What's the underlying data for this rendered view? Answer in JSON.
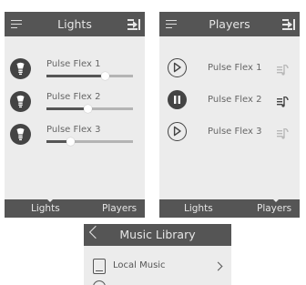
{
  "lights_screen": {
    "title": "Lights",
    "items": [
      {
        "name": "Pulse Flex 1",
        "level": 0.67
      },
      {
        "name": "Pulse Flex 2",
        "level": 0.47
      },
      {
        "name": "Pulse Flex 3",
        "level": 0.27
      }
    ],
    "tabs": [
      "Lights",
      "Players"
    ],
    "active_tab": "Lights"
  },
  "players_screen": {
    "title": "Players",
    "items": [
      {
        "name": "Pulse Flex 1",
        "state": "play",
        "speaker_active": false
      },
      {
        "name": "Pulse Flex 2",
        "state": "pause",
        "speaker_active": true
      },
      {
        "name": "Pulse Flex 3",
        "state": "play",
        "speaker_active": false
      }
    ],
    "tabs": [
      "Lights",
      "Players"
    ],
    "active_tab": "Players"
  },
  "music_library": {
    "title": "Music Library",
    "back_icon": "chevron-left-icon",
    "items": [
      {
        "label": "Local Music",
        "icon": "book-icon"
      }
    ]
  },
  "colors": {
    "header": "#555555",
    "background": "#ececec",
    "icon": "#444444",
    "speaker_inactive": "#b8b8b8"
  }
}
